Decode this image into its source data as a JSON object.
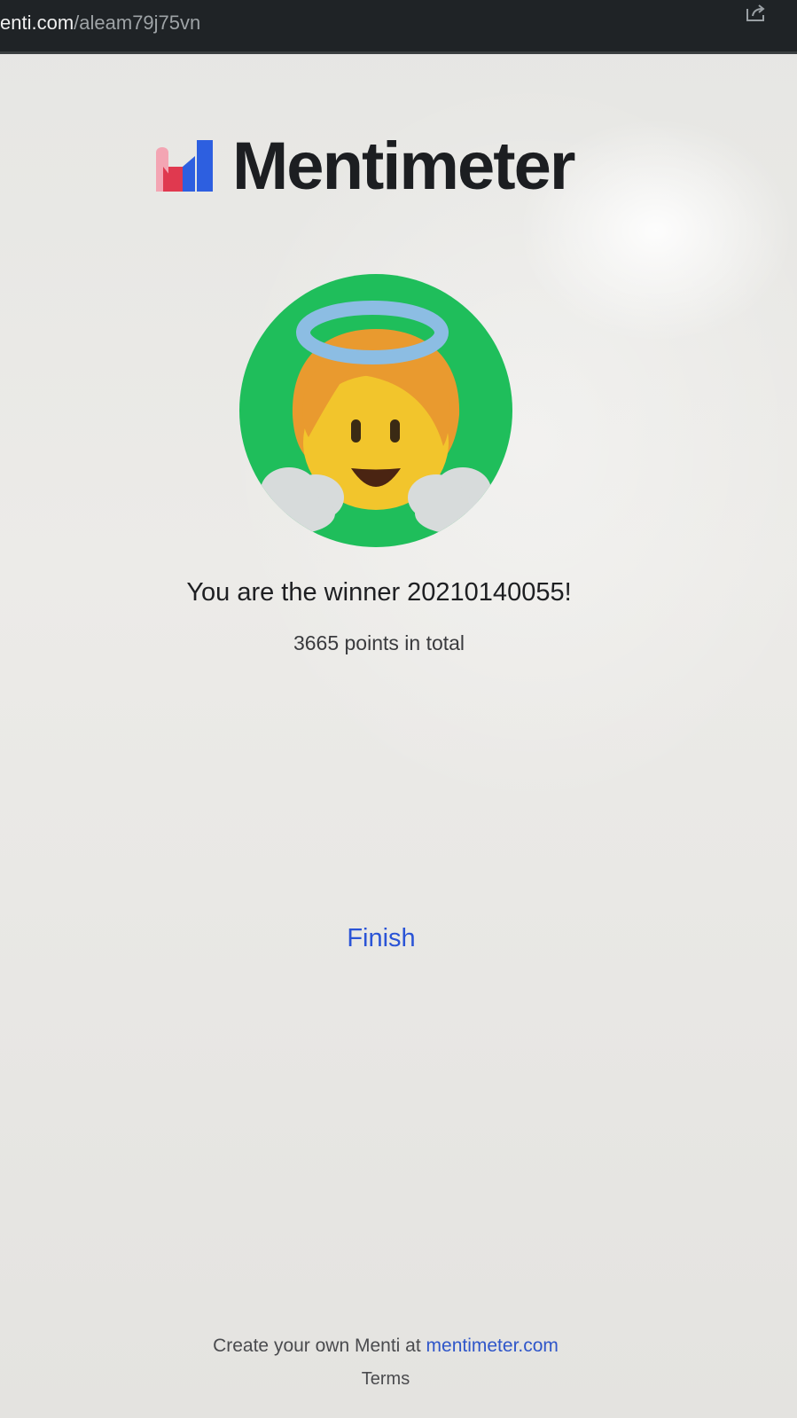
{
  "browser": {
    "url_host": "enti.com",
    "url_path": "/aleam79j75vn"
  },
  "brand": {
    "name": "Mentimeter",
    "logo_colors": [
      "#f3a5b3",
      "#e0394f",
      "#2d5fe0",
      "#1c1e21"
    ]
  },
  "result": {
    "title": "You are the winner 20210140055!",
    "points_text": "3665 points in total"
  },
  "avatar": {
    "icon": "angel-face-icon",
    "colors": {
      "background": "#1fbe5b",
      "halo": "#8cbde3",
      "hair": "#e99a2f",
      "face": "#f2c52c",
      "clouds": "#d7dbdb"
    }
  },
  "actions": {
    "finish_label": "Finish"
  },
  "footer": {
    "create_text": "Create your own Menti at ",
    "link_text": "mentimeter.com",
    "terms_label": "Terms"
  }
}
